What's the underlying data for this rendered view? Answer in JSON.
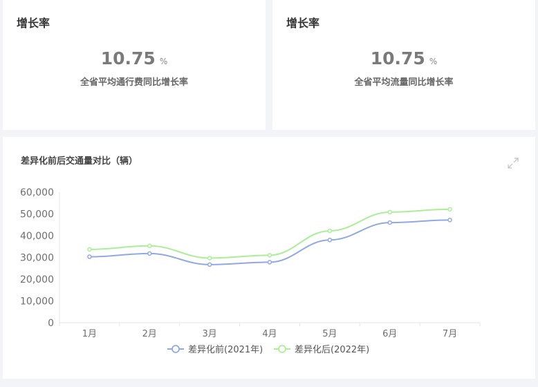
{
  "kpi_left": {
    "title": "增长率",
    "value": "10.75",
    "unit": "%",
    "desc": "全省平均通行费同比增长率"
  },
  "kpi_right": {
    "title": "增长率",
    "value": "10.75",
    "unit": "%",
    "desc": "全省平均流量同比增长率"
  },
  "chart_panel": {
    "title": "差异化前后交通量对比（辆）",
    "expand_icon": "expand-icon"
  },
  "colors": {
    "series_before": "#91a8e6",
    "series_after": "#a9ef96",
    "axis_text": "#6e6e6e",
    "grid": "#e6e6e6"
  },
  "chart_data": {
    "type": "line",
    "smooth": true,
    "categories": [
      "1月",
      "2月",
      "3月",
      "4月",
      "5月",
      "6月",
      "7月"
    ],
    "ylim": [
      0,
      60000
    ],
    "yticks": [
      "0",
      "10,000",
      "20,000",
      "30,000",
      "40,000",
      "50,000",
      "60,000"
    ],
    "legend_position": "bottom-center",
    "series": [
      {
        "name": "差异化前(2021年)",
        "values": [
          30300,
          31800,
          26700,
          27800,
          38000,
          46000,
          47200
        ]
      },
      {
        "name": "差异化后(2022年)",
        "values": [
          33700,
          35300,
          29700,
          31000,
          42200,
          50800,
          52100
        ]
      }
    ]
  }
}
